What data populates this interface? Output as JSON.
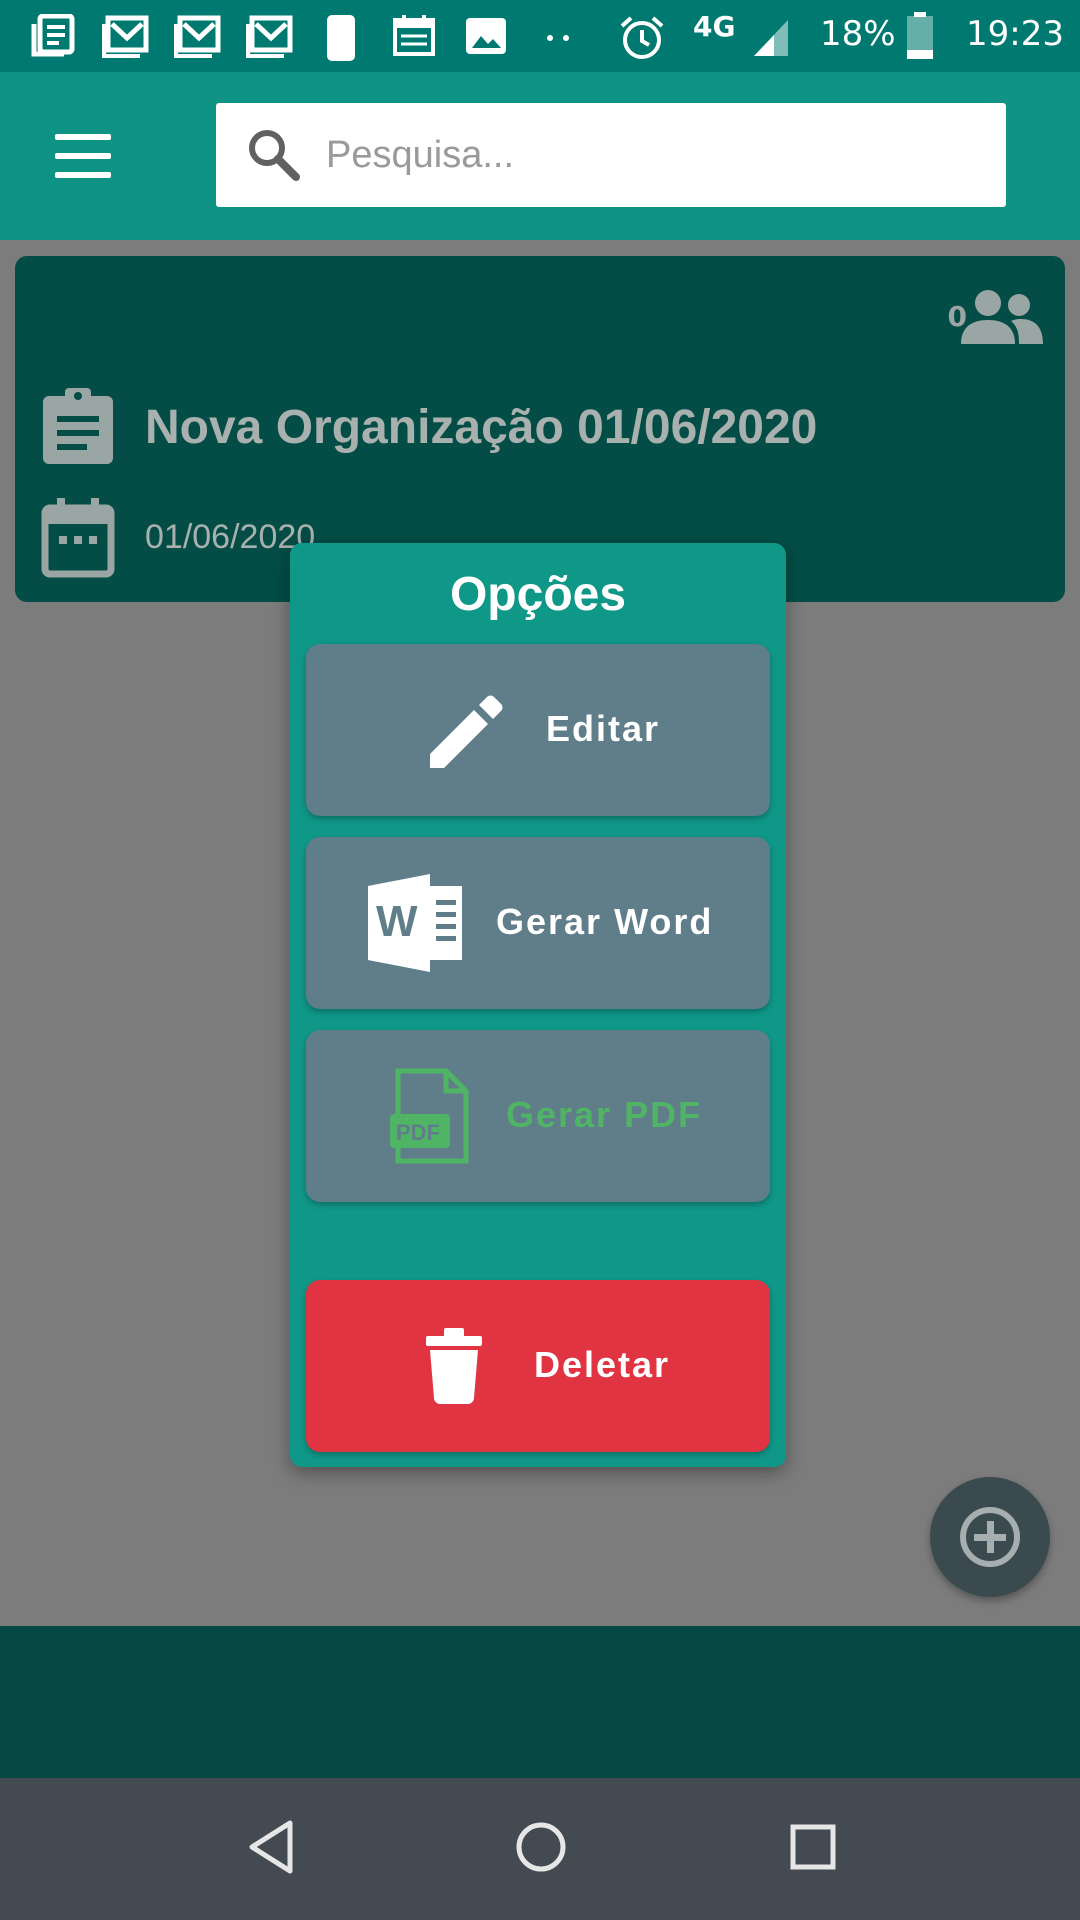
{
  "status_bar": {
    "network": "4G",
    "battery": "18%",
    "time": "19:23",
    "icons": [
      "news-icon",
      "gmail-icon",
      "gmail-icon",
      "gmail-icon",
      "night-mode-icon",
      "calendar-icon",
      "image-icon",
      "more-dots-icon",
      "alarm-icon",
      "signal-icon",
      "battery-icon"
    ]
  },
  "app_bar": {
    "menu_icon": "hamburger-menu-icon",
    "search": {
      "placeholder": "Pesquisa...",
      "value": "",
      "icon": "search-icon"
    }
  },
  "card": {
    "member_count": "0",
    "title": "Nova Organização 01/06/2020",
    "date": "01/06/2020",
    "icons": [
      "people-icon",
      "clipboard-icon",
      "calendar-icon"
    ]
  },
  "dialog": {
    "title": "Opções",
    "options": [
      {
        "label": "Editar",
        "icon": "pencil-icon"
      },
      {
        "label": "Gerar Word",
        "icon": "word-document-icon"
      },
      {
        "label": "Gerar PDF",
        "icon": "pdf-document-icon"
      }
    ],
    "delete": {
      "label": "Deletar",
      "icon": "trash-icon"
    }
  },
  "fab": {
    "icon": "add-circle-icon"
  },
  "nav_bar": {
    "icons": [
      "back-icon",
      "home-icon",
      "recents-icon"
    ]
  },
  "colors": {
    "status_bar": "#007a70",
    "app_bar": "#0f9384",
    "card": "#034d46",
    "dialog": "#0f9788",
    "option_button": "#607d8a",
    "delete_button": "#e03443",
    "pdf_green": "#4fb564",
    "nav_bar": "#434a52"
  }
}
